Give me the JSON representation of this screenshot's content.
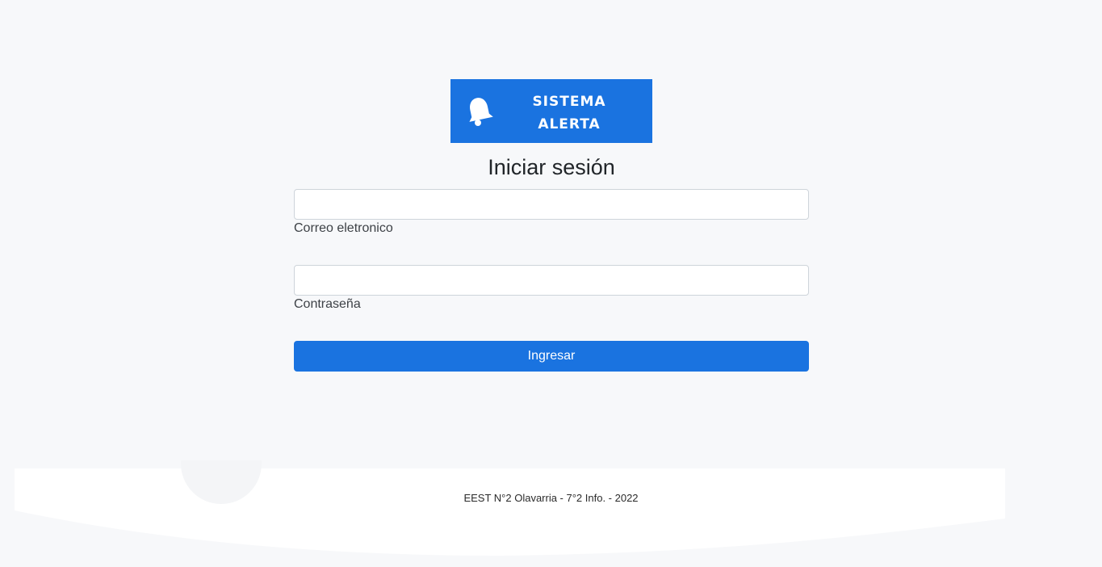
{
  "brand": {
    "line1": "SISTEMA",
    "line2": "ALERTA",
    "icon": "bell-icon",
    "color": "#1a73e0"
  },
  "login": {
    "title": "Iniciar sesión",
    "email_label": "Correo eletronico",
    "email_value": "",
    "password_label": "Contraseña",
    "password_value": "",
    "submit_label": "Ingresar"
  },
  "footer": {
    "text": "EEST N°2 Olavarria - 7°2 Info. - 2022"
  }
}
